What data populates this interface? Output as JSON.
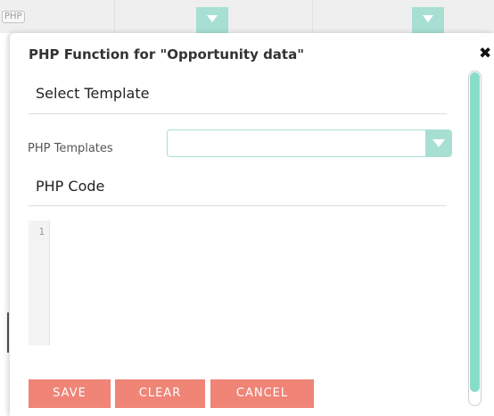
{
  "background": {
    "php_tag": "PHP"
  },
  "modal": {
    "title": "PHP Function for \"Opportunity data\"",
    "close_icon": "close-icon",
    "select_template_header": "Select Template",
    "php_templates_label": "PHP Templates",
    "php_templates_value": "",
    "php_code_header": "PHP Code",
    "editor": {
      "line_numbers": [
        "1"
      ],
      "content": ""
    },
    "buttons": {
      "save": "SAVE",
      "clear": "CLEAR",
      "cancel": "CANCEL"
    }
  },
  "colors": {
    "accent": "#a8dfd3",
    "scrollbar_thumb": "#87ddc9",
    "button": "#ef8477"
  }
}
